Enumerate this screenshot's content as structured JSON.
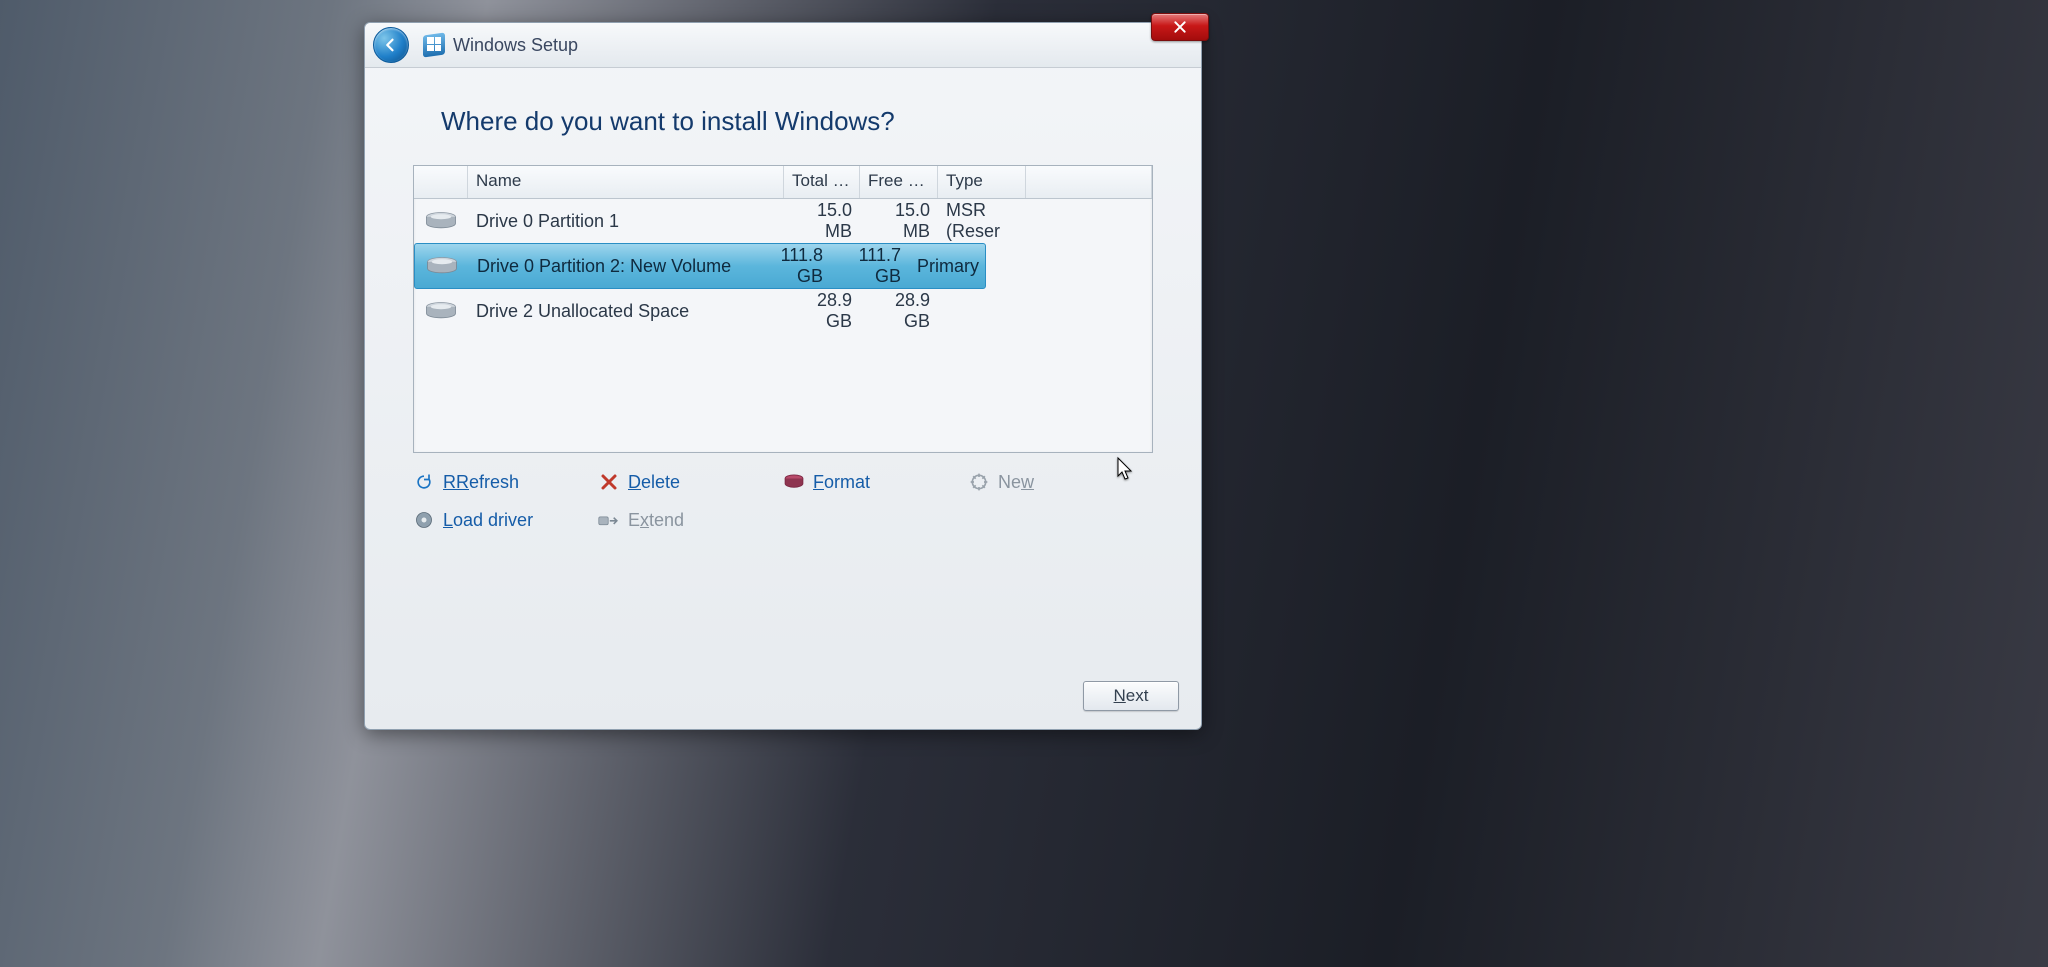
{
  "window": {
    "title": "Windows Setup",
    "page_heading": "Where do you want to install Windows?"
  },
  "columns": {
    "name": "Name",
    "total_size": "Total size",
    "free_space": "Free spa...",
    "type": "Type"
  },
  "partitions": [
    {
      "name": "Drive 0 Partition 1",
      "total": "15.0 MB",
      "free": "15.0 MB",
      "type": "MSR (Reser",
      "selected": false
    },
    {
      "name": "Drive 0 Partition 2: New Volume",
      "total": "111.8 GB",
      "free": "111.7 GB",
      "type": "Primary",
      "selected": true
    },
    {
      "name": "Drive 2 Unallocated Space",
      "total": "28.9 GB",
      "free": "28.9 GB",
      "type": "",
      "selected": false
    }
  ],
  "actions": {
    "refresh": "Refresh",
    "delete": "Delete",
    "format": "Format",
    "new": "New",
    "load_driver": "Load driver",
    "extend": "Extend"
  },
  "footer": {
    "next": "Next"
  }
}
